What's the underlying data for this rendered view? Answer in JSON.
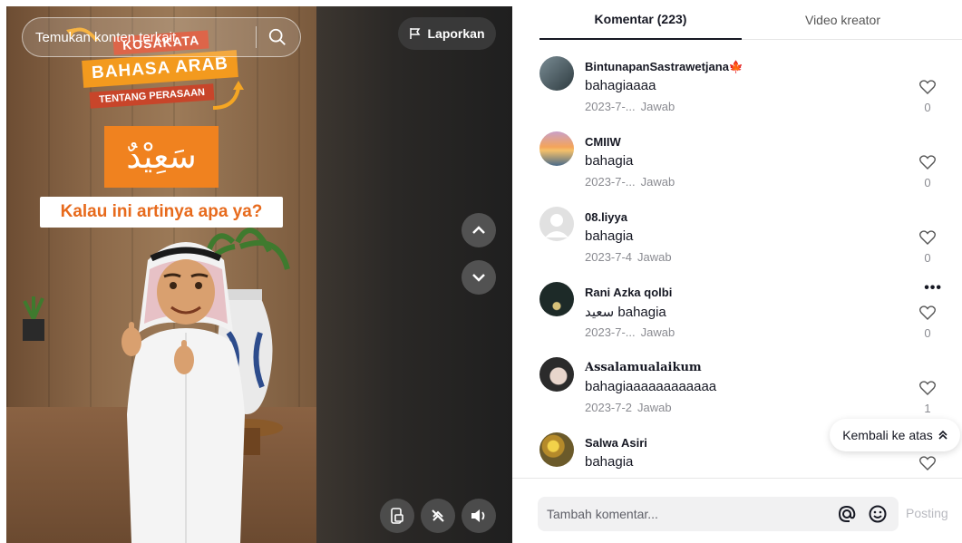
{
  "video": {
    "search_placeholder": "Temukan konten terkait",
    "report_label": "Laporkan",
    "overlay": {
      "kosakata": "KOSAKATA",
      "bahasa_arab": "BAHASA ARAB",
      "tentang": "TENTANG PERASAAN",
      "arabic_word": "سَعِيْدٌ",
      "question": "Kalau ini artinya apa ya?"
    },
    "controls": [
      "device-icon",
      "no-autoscroll-icon",
      "volume-icon"
    ]
  },
  "tabs": {
    "comments": "Komentar (223)",
    "creator": "Video kreator"
  },
  "comments": [
    {
      "user": "BintunapanSastrawetjana🍁",
      "text": "bahagiaaaa",
      "date": "2023-7-...",
      "reply": "Jawab",
      "likes": "0",
      "avatar": "#4a5f6e"
    },
    {
      "user": "CMIIW",
      "text": "bahagia",
      "date": "2023-7-...",
      "reply": "Jawab",
      "likes": "0",
      "avatar": "#e69a57"
    },
    {
      "user": "08.liyya",
      "text": "bahagia",
      "date": "2023-7-4",
      "reply": "Jawab",
      "likes": "0",
      "avatar": "#d9d9d9"
    },
    {
      "user": "Rani Azka qolbi",
      "text": "سعيد bahagia",
      "date": "2023-7-...",
      "reply": "Jawab",
      "likes": "0",
      "avatar": "#1d2a28",
      "more": "•••"
    },
    {
      "user": "Assalamualaikum",
      "text": "bahagiaaaaaaaaaaaa",
      "date": "2023-7-2",
      "reply": "Jawab",
      "likes": "1",
      "avatar": "#3a3a3a"
    },
    {
      "user": "Salwa Asiri",
      "text": "bahagia",
      "date": "",
      "reply": "",
      "likes": "",
      "avatar": "#d8b03a"
    }
  ],
  "back_to_top": "Kembali ke atas",
  "composer": {
    "placeholder": "Tambah komentar...",
    "post_label": "Posting"
  }
}
